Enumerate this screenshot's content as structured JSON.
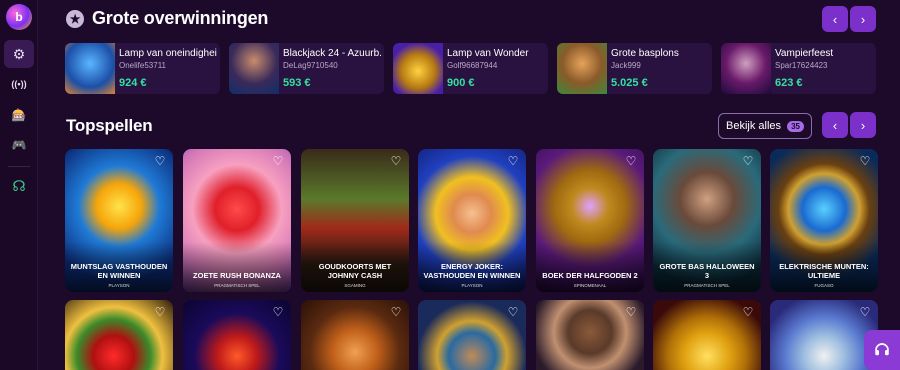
{
  "nav": {
    "logo_text": "b",
    "items": [
      {
        "icon": "gear-icon",
        "glyph": "⚙"
      },
      {
        "icon": "broadcast-icon",
        "glyph": "((•))"
      },
      {
        "icon": "slot-machine-icon",
        "glyph": "🎰"
      },
      {
        "icon": "gamepad-icon",
        "glyph": "🎮"
      },
      {
        "icon": "support-agent-icon",
        "glyph": "☊"
      }
    ]
  },
  "wins": {
    "title": "Grote overwinningen",
    "items": [
      {
        "game": "Lamp van oneindigheid",
        "user": "Onelife53711",
        "amount": "924 €"
      },
      {
        "game": "Blackjack 24 - Azuurb...",
        "user": "DeLag9710540",
        "amount": "593 €"
      },
      {
        "game": "Lamp van Wonder",
        "user": "Golf96687944",
        "amount": "900 €"
      },
      {
        "game": "Grote basplons",
        "user": "Jack999",
        "amount": "5.025 €"
      },
      {
        "game": "Vampierfeest",
        "user": "Spar17624423",
        "amount": "623 €"
      }
    ]
  },
  "top": {
    "title": "Topspellen",
    "view_all": "Bekijk alles",
    "count": "35",
    "games": [
      {
        "name": "MUNTSLAG VASTHOUDEN EN WINNEN",
        "provider": "PLAYSON"
      },
      {
        "name": "ZOETE RUSH BONANZA",
        "provider": "PRAGMATISCH SPEL"
      },
      {
        "name": "GOUDKOORTS MET JOHNNY CASH",
        "provider": "SGAMING"
      },
      {
        "name": "ENERGY JOKER: VASTHOUDEN EN WINNEN",
        "provider": "PLAYSON"
      },
      {
        "name": "BOEK DER HALFGODEN 2",
        "provider": "SPINOMENAAL"
      },
      {
        "name": "GROTE BAS HALLOWEEN 3",
        "provider": "PRAGMATISCH SPEL"
      },
      {
        "name": "ELEKTRISCHE MUNTEN: ULTIEME",
        "provider": "FUGASO"
      }
    ]
  },
  "colors": {
    "accent": "#7a30c9",
    "win_amount": "#34e0a0",
    "background": "#1d0a2b"
  }
}
